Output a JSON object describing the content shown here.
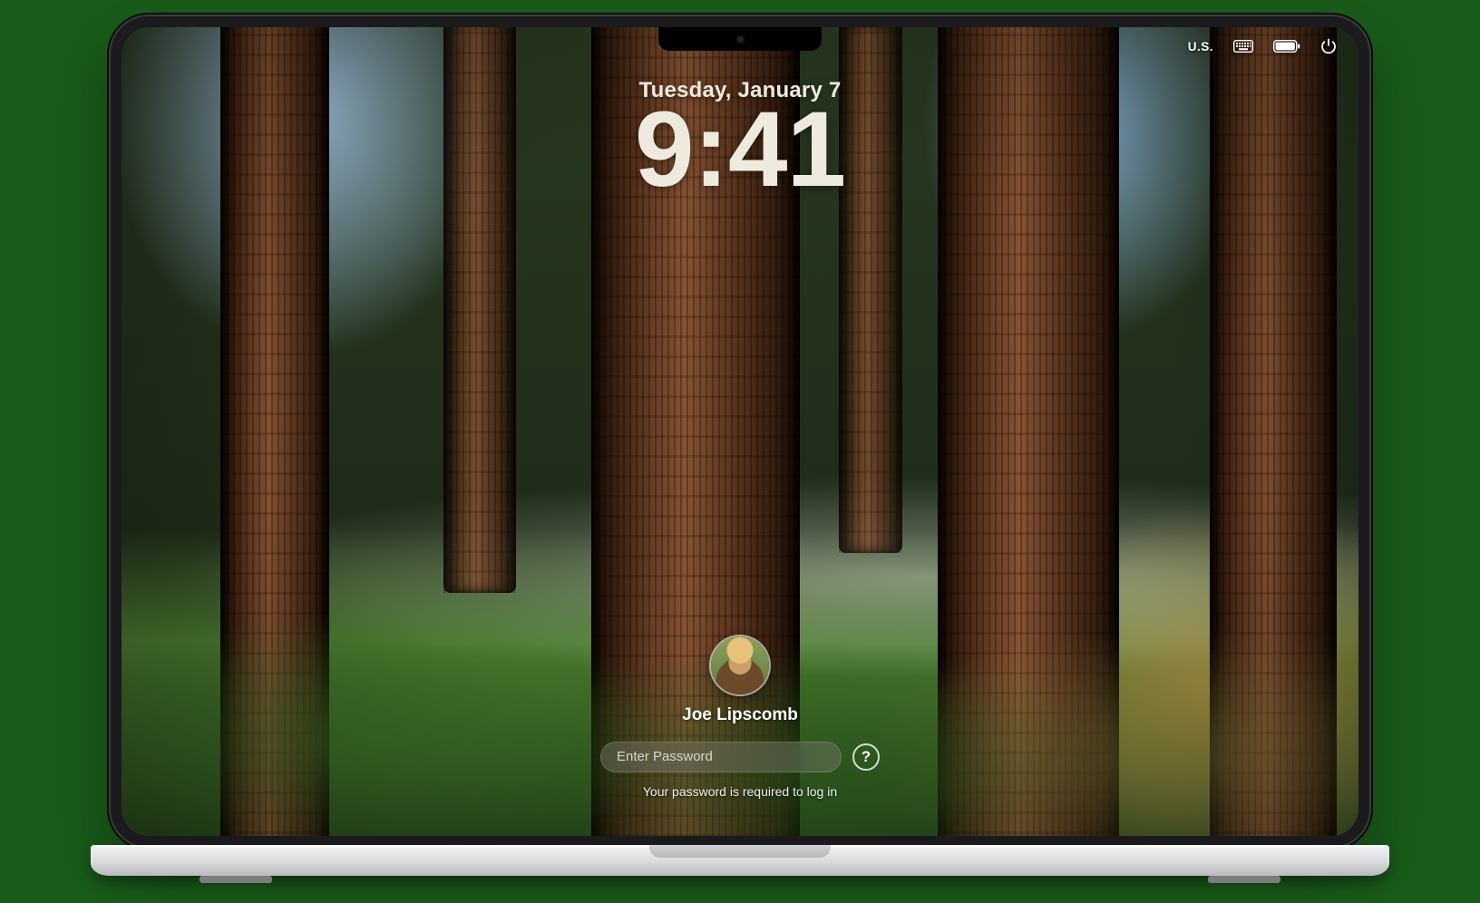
{
  "menubar": {
    "input_source": "U.S."
  },
  "clock": {
    "date": "Tuesday, January 7",
    "time": "9:41"
  },
  "login": {
    "username": "Joe Lipscomb",
    "password_placeholder": "Enter Password",
    "password_value": "",
    "hint_glyph": "?",
    "message": "Your password is required to log in"
  }
}
